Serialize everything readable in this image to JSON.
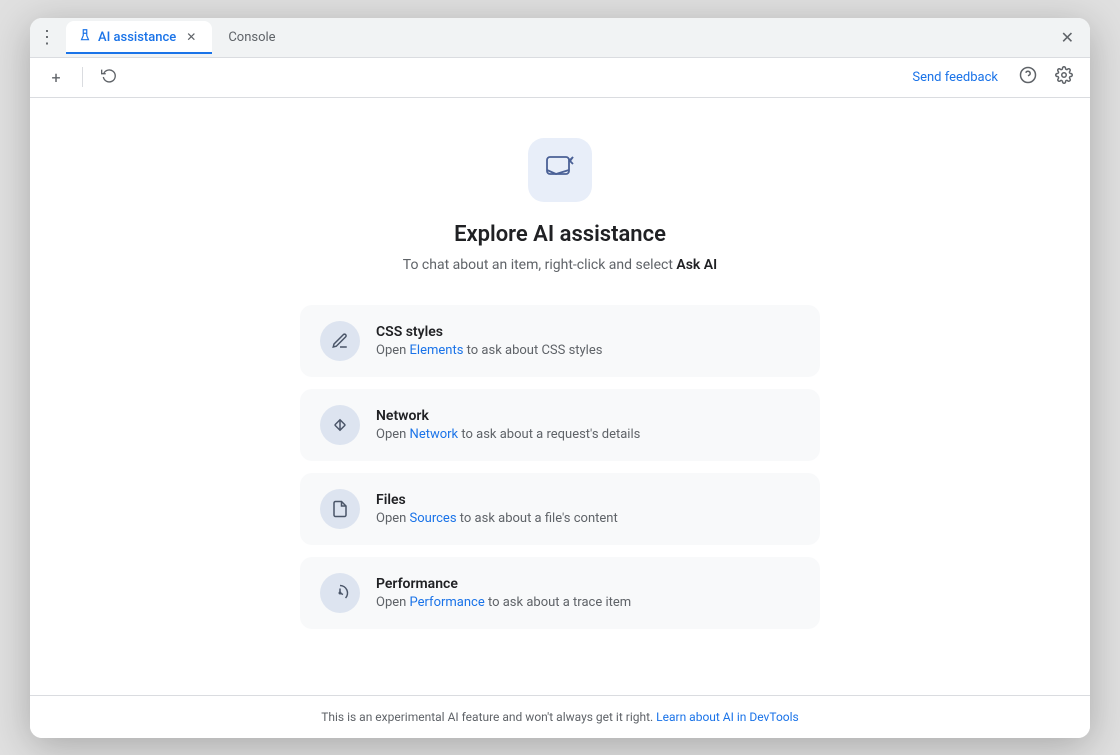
{
  "window": {
    "border_radius": "12px"
  },
  "tab_bar": {
    "dots_icon": "⋮",
    "tabs": [
      {
        "id": "ai-assistance",
        "label": "AI assistance",
        "icon": "🧪",
        "active": true,
        "closeable": true
      },
      {
        "id": "console",
        "label": "Console",
        "active": false,
        "closeable": false
      }
    ],
    "close_icon": "✕"
  },
  "toolbar": {
    "add_icon": "+",
    "history_icon": "↺",
    "send_feedback_label": "Send feedback",
    "help_icon": "?",
    "settings_icon": "⚙"
  },
  "main": {
    "icon_label": "ai-chat-icon",
    "title": "Explore AI assistance",
    "subtitle_text": "To chat about an item, right-click and select ",
    "subtitle_bold": "Ask AI",
    "features": [
      {
        "id": "css-styles",
        "title": "CSS styles",
        "desc_prefix": "Open ",
        "link_label": "Elements",
        "desc_suffix": " to ask about CSS styles",
        "icon_type": "pen"
      },
      {
        "id": "network",
        "title": "Network",
        "desc_prefix": "Open ",
        "link_label": "Network",
        "desc_suffix": " to ask about a request's details",
        "icon_type": "arrows"
      },
      {
        "id": "files",
        "title": "Files",
        "desc_prefix": "Open ",
        "link_label": "Sources",
        "desc_suffix": " to ask about a file's content",
        "icon_type": "file"
      },
      {
        "id": "performance",
        "title": "Performance",
        "desc_prefix": "Open ",
        "link_label": "Performance",
        "desc_suffix": " to ask about a trace item",
        "icon_type": "gauge"
      }
    ]
  },
  "footer": {
    "text": "This is an experimental AI feature and won't always get it right. ",
    "link_label": "Learn about AI in DevTools"
  }
}
